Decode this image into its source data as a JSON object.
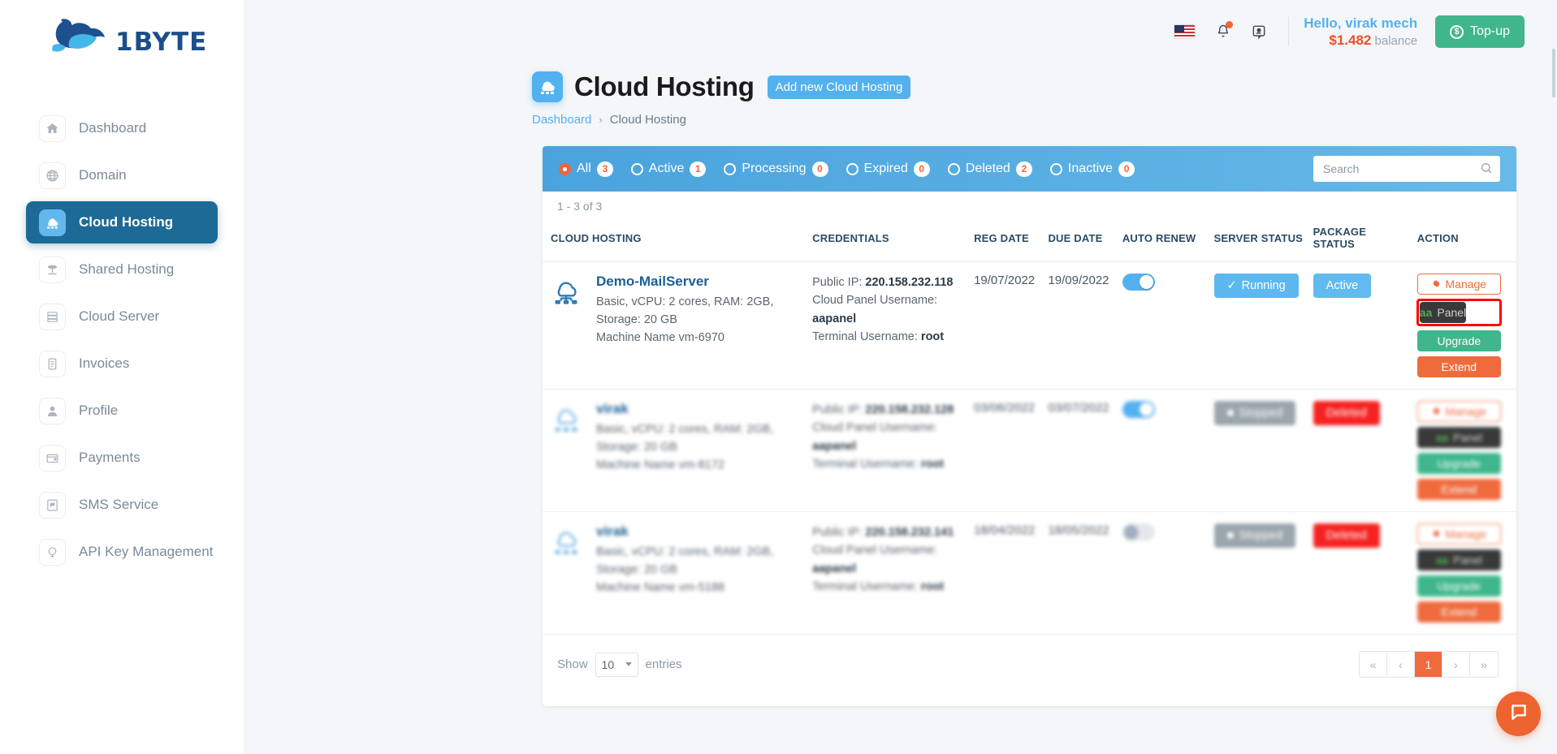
{
  "brand": {
    "logo_text": "1BYTE",
    "logo_icon": "whale-logo-icon"
  },
  "sidebar": {
    "items": [
      {
        "label": "Dashboard",
        "icon": "home-icon",
        "active": false
      },
      {
        "label": "Domain",
        "icon": "globe-icon",
        "active": false
      },
      {
        "label": "Cloud Hosting",
        "icon": "cloud-hosting-icon",
        "active": true
      },
      {
        "label": "Shared Hosting",
        "icon": "shared-hosting-icon",
        "active": false
      },
      {
        "label": "Cloud Server",
        "icon": "server-icon",
        "active": false
      },
      {
        "label": "Invoices",
        "icon": "invoice-icon",
        "active": false
      },
      {
        "label": "Profile",
        "icon": "user-icon",
        "active": false
      },
      {
        "label": "Payments",
        "icon": "wallet-icon",
        "active": false
      },
      {
        "label": "SMS Service",
        "icon": "sms-icon",
        "active": false
      },
      {
        "label": "API Key Management",
        "icon": "api-key-icon",
        "active": false
      }
    ]
  },
  "topbar": {
    "language_flag": "us-flag-icon",
    "notification_icon": "bell-icon",
    "support_icon": "support-ticket-icon",
    "greeting": "Hello, virak mech",
    "balance_amount": "$1.482",
    "balance_label": "balance",
    "topup_label": "Top-up",
    "topup_icon": "dollar-coin-icon",
    "topup_color": "#3fb68b"
  },
  "page": {
    "title": "Cloud Hosting",
    "title_icon": "cloud-hosting-icon",
    "add_button": "Add new Cloud Hosting",
    "breadcrumb": {
      "parent": "Dashboard",
      "separator": "›",
      "current": "Cloud Hosting"
    }
  },
  "filters": {
    "items": [
      {
        "label": "All",
        "count": "3",
        "selected": true
      },
      {
        "label": "Active",
        "count": "1",
        "selected": false
      },
      {
        "label": "Processing",
        "count": "0",
        "selected": false
      },
      {
        "label": "Expired",
        "count": "0",
        "selected": false
      },
      {
        "label": "Deleted",
        "count": "2",
        "selected": false
      },
      {
        "label": "Inactive",
        "count": "0",
        "selected": false
      }
    ]
  },
  "search": {
    "value": "",
    "placeholder": "Search",
    "icon": "search-icon"
  },
  "table": {
    "result_count": "1 - 3 of 3",
    "headers": [
      "CLOUD HOSTING",
      "CREDENTIALS",
      "REG DATE",
      "DUE DATE",
      "AUTO RENEW",
      "SERVER STATUS",
      "PACKAGE STATUS",
      "ACTION"
    ],
    "rows": [
      {
        "blurred": false,
        "name": "Demo-MailServer",
        "spec": "Basic, vCPU: 2 cores, RAM: 2GB, Storage: 20 GB",
        "machine": "Machine Name vm-6970",
        "cred_ip_label": "Public IP:",
        "cred_ip_value": "220.158.232.118",
        "cred_panel_label": "Cloud Panel Username:",
        "cred_panel_value": "aapanel",
        "cred_term_label": "Terminal Username:",
        "cred_term_value": "root",
        "reg_date": "19/07/2022",
        "due_date": "19/09/2022",
        "auto_renew_on": true,
        "server_status": "Running",
        "server_status_state": "running",
        "package_status": "Active",
        "package_status_state": "active",
        "actions": {
          "manage": "Manage",
          "aapanel_prefix": "aa",
          "aapanel_suffix": "Panel",
          "upgrade": "Upgrade",
          "extend": "Extend",
          "highlighted": "aapanel"
        }
      },
      {
        "blurred": true,
        "name": "virak",
        "spec": "Basic, vCPU: 2 cores, RAM: 2GB, Storage: 20 GB",
        "machine": "Machine Name vm-8172",
        "cred_ip_label": "Public IP:",
        "cred_ip_value": "220.158.232.128",
        "cred_panel_label": "Cloud Panel Username:",
        "cred_panel_value": "aapanel",
        "cred_term_label": "Terminal Username:",
        "cred_term_value": "root",
        "reg_date": "03/06/2022",
        "due_date": "03/07/2022",
        "auto_renew_on": true,
        "server_status": "Stopped",
        "server_status_state": "stopped",
        "package_status": "Deleted",
        "package_status_state": "deleted",
        "actions": {
          "manage": "Manage",
          "aapanel_prefix": "aa",
          "aapanel_suffix": "Panel",
          "upgrade": "Upgrade",
          "extend": "Extend",
          "highlighted": ""
        }
      },
      {
        "blurred": true,
        "name": "virak",
        "spec": "Basic, vCPU: 2 cores, RAM: 2GB, Storage: 20 GB",
        "machine": "Machine Name vm-5188",
        "cred_ip_label": "Public IP:",
        "cred_ip_value": "220.158.232.141",
        "cred_panel_label": "Cloud Panel Username:",
        "cred_panel_value": "aapanel",
        "cred_term_label": "Terminal Username:",
        "cred_term_value": "root",
        "reg_date": "18/04/2022",
        "due_date": "18/05/2022",
        "auto_renew_on": false,
        "server_status": "Stopped",
        "server_status_state": "stopped",
        "package_status": "Deleted",
        "package_status_state": "deleted",
        "actions": {
          "manage": "Manage",
          "aapanel_prefix": "aa",
          "aapanel_suffix": "Panel",
          "upgrade": "Upgrade",
          "extend": "Extend",
          "highlighted": ""
        }
      }
    ]
  },
  "footer": {
    "show_label": "Show",
    "entries_value": "10",
    "entries_label": "entries",
    "pager": {
      "first": "«",
      "prev": "‹",
      "current": "1",
      "next": "›",
      "last": "»"
    }
  },
  "chat": {
    "icon": "chat-bubble-icon",
    "color": "#ee6430"
  }
}
